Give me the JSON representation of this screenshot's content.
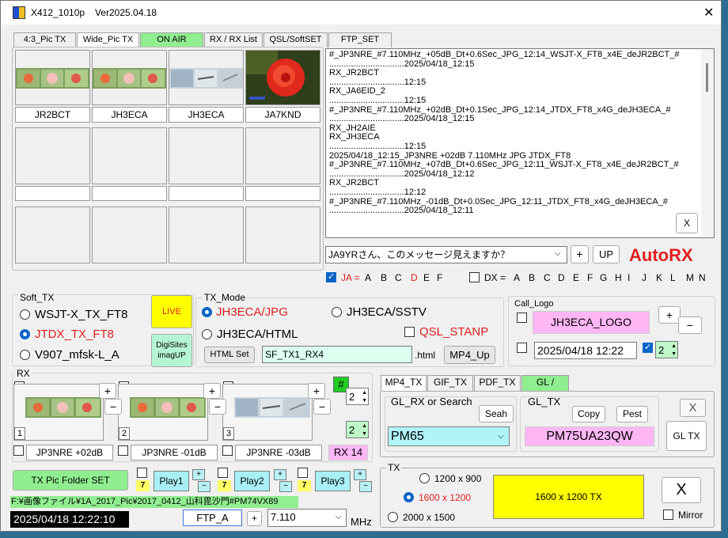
{
  "window": {
    "title": "X412_1010p",
    "version": "Ver2025.04.18",
    "close": "✕"
  },
  "tabs": [
    "4:3_Pic TX",
    "Wide_Pic TX",
    "ON AIR",
    "RX / RX List",
    "QSL/SoftSET",
    "FTP_SET"
  ],
  "thumbs": {
    "captions": [
      "JR2BCT",
      "JH3ECA",
      "JH3ECA",
      "JA7KND"
    ]
  },
  "log": {
    "lines": [
      "#_JP3NRE_#7.110MHz_+05dB_Dt+0.6Sec_JPG_12:14_WSJT-X_FT8_x4E_deJR2BCT_#",
      "...............................2025/04/18_12:15",
      "RX_JR2BCT",
      "...............................12:15",
      "RX_JA6EID_2",
      "...............................12:15",
      "#_JP3NRE_#7.110MHz_+02dB_Dt+0.1Sec_JPG_12:14_JTDX_FT8_x4G_deJH3ECA_#",
      "...............................2025/04/18_12:15",
      "RX_JH2AIE",
      "RX_JH3ECA",
      "...............................12:15",
      "2025/04/18_12:15_JP3NRE +02dB  7.110MHz  JPG  JTDX_FT8",
      "#_JP3NRE_#7.110MHz_+07dB_Dt+0.6Sec_JPG_12:11_WSJT-X_FT8_x4E_deJR2BCT_#",
      "...............................2025/04/18_12:12",
      "RX_JR2BCT",
      "...............................12:12",
      "#_JP3NRE_#7.110MHz_-01dB_Dt+0.0Sec_JPG_12:11_JTDX_FT8_x4G_deJH3ECA_#",
      "...............................2025/04/18_12:11"
    ],
    "clear": "X"
  },
  "message": {
    "value": "JA9YRさん、このメッセージ見えますか？",
    "plus": "+",
    "up": "UP",
    "autorx": "AutoRX"
  },
  "filters": {
    "ja_label": "JA =",
    "ja_letters": [
      "A",
      "B",
      "C",
      "D",
      "E",
      "F"
    ],
    "dx_label": "DX =",
    "dx_letters": [
      "A",
      "B",
      "C",
      "D",
      "E",
      "F",
      "G",
      "H",
      "I",
      "J",
      "K",
      "L",
      "M",
      "N"
    ]
  },
  "soft_tx": {
    "title": "Soft_TX",
    "options": [
      "WSJT-X_TX_FT8",
      "JTDX_TX_FT8",
      "V907_mfsk-L_A"
    ],
    "live": "LIVE",
    "digisites": "DigiSites",
    "imagup": "imagUP"
  },
  "tx_mode": {
    "title": "TX_Mode",
    "jpg": "JH3ECA/JPG",
    "sstv": "JH3ECA/SSTV",
    "html": "JH3ECA/HTML",
    "qsl": "QSL_STANP",
    "html_set": "HTML Set",
    "file": "SF_TX1_RX4",
    "ext": ".html",
    "mp4": "MP4_Up"
  },
  "call_logo": {
    "title": "Call_Logo",
    "logo": "JH3ECA_LOGO",
    "plus": "+",
    "minus": "−",
    "datetime": "2025/04/18  12:22",
    "spin": "2"
  },
  "rx": {
    "title": "RX",
    "hash": "#",
    "spin1": "2",
    "spin2": "2",
    "labels": [
      "JP3NRE +02dB",
      "JP3NRE -01dB",
      "JP3NRE -03dB"
    ],
    "nums": [
      "1",
      "2",
      "3"
    ],
    "rx14": "RX 14",
    "plus": "+",
    "minus": "−"
  },
  "gl": {
    "tabs": [
      "MP4_TX",
      "GIF_TX",
      "PDF_TX",
      "GL /"
    ],
    "rx_title": "GL_RX or Search",
    "seah": "Seah",
    "rx_value": "PM65",
    "tx_title": "GL_TX",
    "copy": "Copy",
    "pest": "Pest",
    "tx_value": "PM75UA23QW",
    "x": "X",
    "gltx": "GL TX"
  },
  "bottom": {
    "folder": "TX Pic  Folder SET",
    "seven": "7",
    "plays": [
      "Play1",
      "Play2",
      "Play3"
    ],
    "path": "F:¥画像ファイル¥1A_2017_Pic¥2017_0412_山科毘沙門#PM74VX89",
    "clock": "2025/04/18   12:22:10",
    "ftp": "FTP_A",
    "plus": "+",
    "freq": "7.110",
    "mhz": "MHz"
  },
  "tx": {
    "title": "TX",
    "sizes": [
      "1200 x 900",
      "1600 x 1200",
      "2000 x 1500"
    ],
    "big": "1600 x 1200   TX",
    "x": "X",
    "mirror": "Mirror"
  },
  "colors": {
    "accent": "#0a64c8",
    "red": "#e02020",
    "onair": "#90ee90",
    "yellow": "#ffff00",
    "pink": "#ffb6f5",
    "cyan": "#b0f4f8"
  }
}
